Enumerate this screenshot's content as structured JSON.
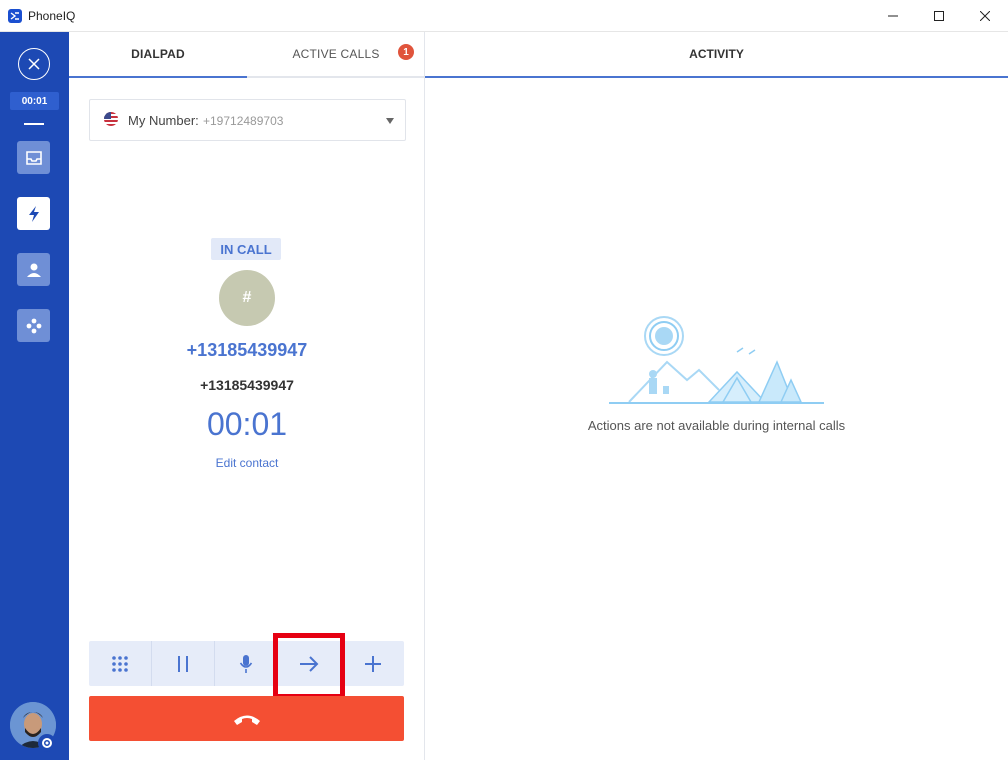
{
  "window": {
    "title": "PhoneIQ"
  },
  "rail": {
    "timer": "00:01",
    "items": [
      {
        "icon": "inbox-icon"
      },
      {
        "icon": "lightning-icon"
      },
      {
        "icon": "contact-icon"
      },
      {
        "icon": "integrations-icon"
      }
    ]
  },
  "tabs": {
    "dialpad": "DIALPAD",
    "active_calls": "ACTIVE CALLS",
    "active_calls_count": "1"
  },
  "number_select": {
    "label": "My Number:",
    "value": "+19712489703"
  },
  "call": {
    "status": "IN CALL",
    "avatar_char": "#",
    "name": "+13185439947",
    "number": "+13185439947",
    "timer": "00:01",
    "edit_label": "Edit contact"
  },
  "activity": {
    "tab": "ACTIVITY",
    "empty_message": "Actions are not available during internal calls"
  },
  "colors": {
    "brand": "#1d49b4",
    "accent": "#4a74d0",
    "hangup": "#f44f33",
    "highlight": "#e60012"
  }
}
